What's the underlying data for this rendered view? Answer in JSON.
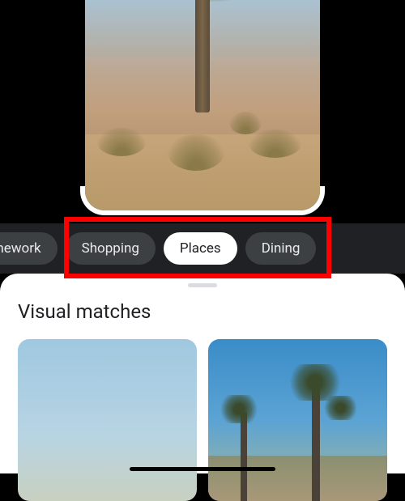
{
  "chips": [
    {
      "label": "Homework",
      "active": false
    },
    {
      "label": "Shopping",
      "active": false
    },
    {
      "label": "Places",
      "active": true
    },
    {
      "label": "Dining",
      "active": false
    }
  ],
  "results": {
    "section_title": "Visual matches"
  },
  "annotation": {
    "highlight_color": "#ff0000"
  }
}
